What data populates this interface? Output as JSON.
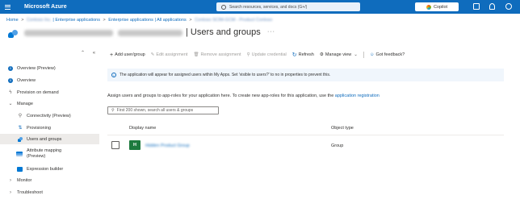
{
  "topbar": {
    "brand": "Microsoft Azure",
    "search_placeholder": "Search resources, services, and docs (G+/)",
    "copilot_label": "Copilot",
    "accent": "#0f6cbd"
  },
  "breadcrumb": {
    "items": [
      "Home",
      "Contoso Inc.",
      "Enterprise applications",
      "Enterprise applications | All applications",
      "Contoso SCIM-GCM - Product Contoso"
    ],
    "separator": ">"
  },
  "header": {
    "title": "| Users and groups",
    "more": "···"
  },
  "sidebar": {
    "collapse": "«",
    "expand_toggle": "⌃",
    "items": [
      {
        "label": "Overview (Preview)",
        "icon": "info-icon"
      },
      {
        "label": "Overview",
        "icon": "info-icon"
      },
      {
        "label": "Provision on demand",
        "icon": "wrench-icon"
      },
      {
        "label": "Manage",
        "icon": "chevron-down-icon"
      },
      {
        "label": "Connectivity (Preview)",
        "icon": "plug-icon"
      },
      {
        "label": "Provisioning",
        "icon": "sync-icon"
      },
      {
        "label": "Users and groups",
        "icon": "people-icon"
      },
      {
        "label": "Attribute mapping",
        "label2": "(Preview)",
        "icon": "mapping-icon"
      },
      {
        "label": "Expression builder",
        "icon": "expression-icon"
      },
      {
        "label": "Monitor",
        "icon": "chevron-right-icon"
      },
      {
        "label": "Troubleshoot",
        "icon": "chevron-right-icon"
      }
    ]
  },
  "toolbar": {
    "add": "Add user/group",
    "edit": "Edit assignment",
    "remove": "Remove assignment",
    "update": "Update credential",
    "refresh": "Refresh",
    "manage_view": "Manage view",
    "feedback": "Got feedback?"
  },
  "banner": {
    "text": "The application will appear for assigned users within My Apps. Set 'visible to users?' to no in properties to prevent this."
  },
  "description": {
    "text": "Assign users and groups to app-roles for your application here. To create new app-roles for this application, use the ",
    "link": "application registration"
  },
  "filter": {
    "placeholder": "First 200 shown, search all users & groups"
  },
  "table": {
    "columns": [
      "Display name",
      "Object type"
    ],
    "rows": [
      {
        "initials": "H",
        "name": "Hidden Product Group",
        "type": "Group"
      }
    ]
  }
}
